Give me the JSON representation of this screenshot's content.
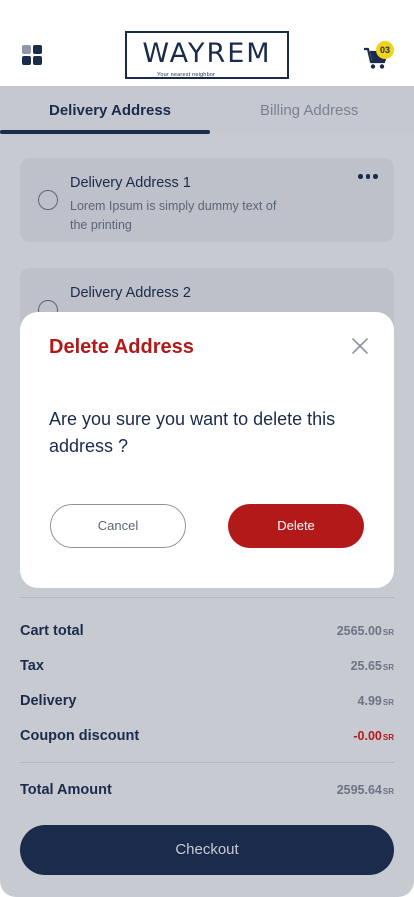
{
  "header": {
    "logo_text": "WAYREM",
    "logo_tagline": "Your nearest neighbor",
    "cart_count": "03",
    "icons": {
      "menu": "grid-menu-icon",
      "cart": "shopping-cart-icon"
    }
  },
  "tabs": [
    {
      "label": "Delivery Address",
      "active": true
    },
    {
      "label": "Billing  Address",
      "active": false
    }
  ],
  "addresses": [
    {
      "title": "Delivery Address 1",
      "description": "Lorem Ipsum is simply dummy text of the printing"
    },
    {
      "title": "Delivery Address 2",
      "description": ""
    }
  ],
  "summary": {
    "currency": "SR",
    "rows": [
      {
        "label": "Cart total",
        "value": "2565.00"
      },
      {
        "label": "Tax",
        "value": "25.65"
      },
      {
        "label": "Delivery",
        "value": "4.99"
      },
      {
        "label": "Coupon discount",
        "value": "-0.00"
      }
    ],
    "total_label": "Total Amount",
    "total_value": "2595.64"
  },
  "checkout_label": "Checkout",
  "modal": {
    "title": "Delete Address",
    "message": "Are you sure you want to delete this address ?",
    "cancel_label": "Cancel",
    "delete_label": "Delete"
  },
  "colors": {
    "primary": "#1a2b4c",
    "danger": "#b21a1a",
    "badge": "#f2d31c",
    "overlay_bg": "#c7cad1"
  }
}
